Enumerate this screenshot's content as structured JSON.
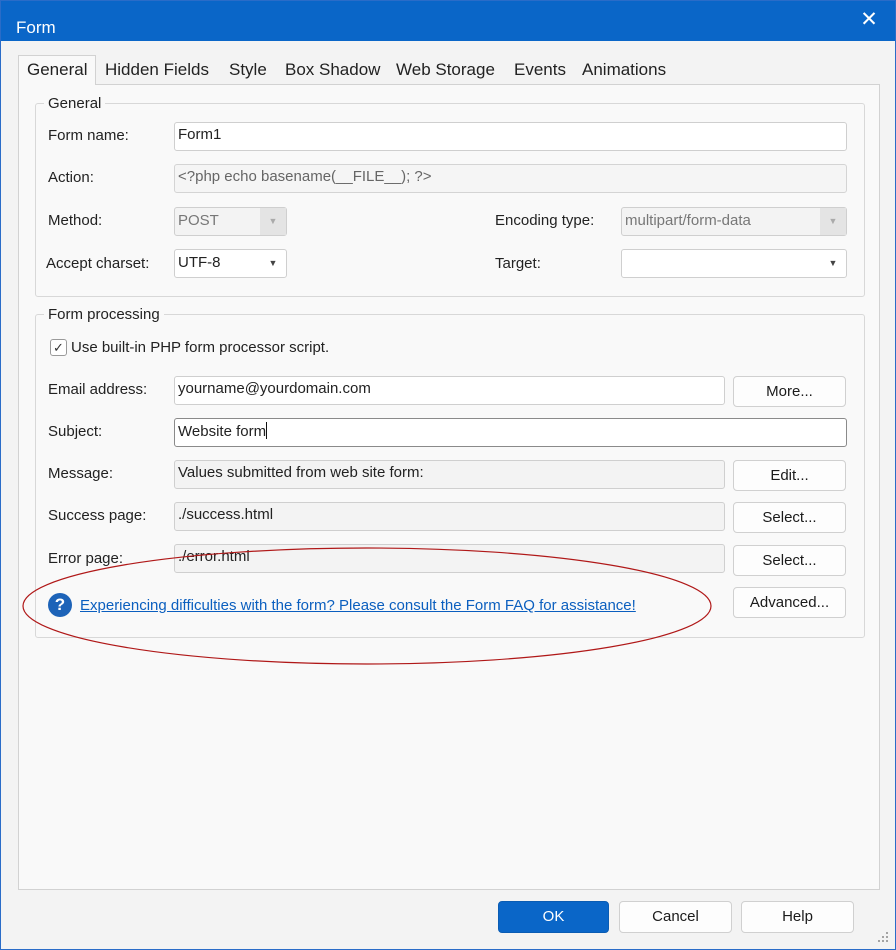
{
  "window": {
    "title": "Form",
    "close_glyph": "✕"
  },
  "tabs": [
    "General",
    "Hidden Fields",
    "Style",
    "Box Shadow",
    "Web Storage",
    "Events",
    "Animations"
  ],
  "general_group": {
    "legend": "General",
    "form_name_label": "Form name:",
    "form_name_value": "Form1",
    "action_label": "Action:",
    "action_value": "<?php echo basename(__FILE__); ?>",
    "method_label": "Method:",
    "method_value": "POST",
    "encoding_label": "Encoding type:",
    "encoding_value": "multipart/form-data",
    "charset_label": "Accept charset:",
    "charset_value": "UTF-8",
    "target_label": "Target:",
    "target_value": ""
  },
  "processing_group": {
    "legend": "Form processing",
    "use_builtin_label": "Use built-in PHP form processor script.",
    "use_builtin_checked": true,
    "email_label": "Email address:",
    "email_value": "yourname@yourdomain.com",
    "more_button": "More...",
    "subject_label": "Subject:",
    "subject_value": "Website form",
    "message_label": "Message:",
    "message_value": "Values submitted from web site form:",
    "edit_button": "Edit...",
    "success_label": "Success page:",
    "success_value": "./success.html",
    "select_button": "Select...",
    "error_label": "Error page:",
    "error_value": "./error.html",
    "help_link": "Experiencing difficulties with the form? Please consult the Form FAQ for assistance!",
    "advanced_button": "Advanced..."
  },
  "footer": {
    "ok": "OK",
    "cancel": "Cancel",
    "help": "Help"
  },
  "colors": {
    "accent": "#0a66c8",
    "link": "#0b5fbf",
    "annotation": "#b01818"
  },
  "icons": {
    "close": "close-icon",
    "help": "help-icon",
    "check": "checkmark-icon",
    "dropdown": "chevron-down-icon",
    "grip": "resize-grip-icon"
  }
}
